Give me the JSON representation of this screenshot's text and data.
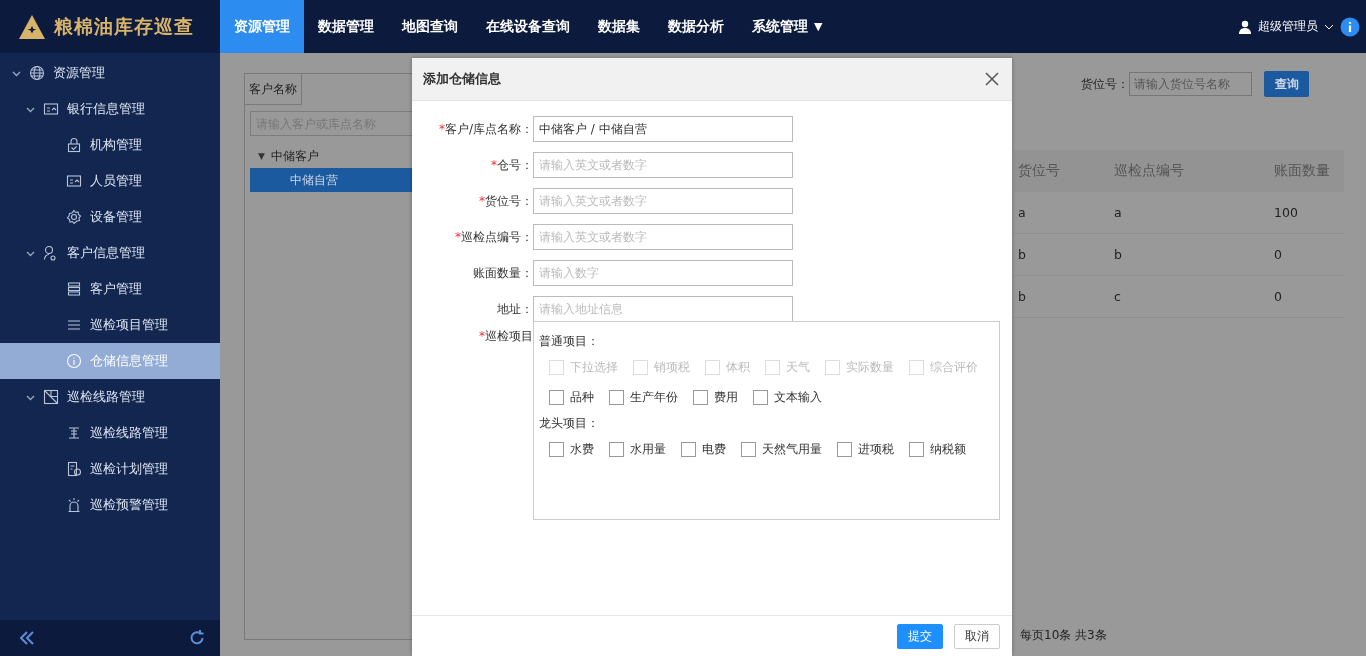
{
  "header": {
    "app_title": "粮棉油库存巡查",
    "nav": [
      {
        "label": "资源管理",
        "selected": true
      },
      {
        "label": "数据管理",
        "selected": false
      },
      {
        "label": "地图查询",
        "selected": false
      },
      {
        "label": "在线设备查询",
        "selected": false
      },
      {
        "label": "数据集",
        "selected": false
      },
      {
        "label": "数据分析",
        "selected": false
      },
      {
        "label": "系统管理",
        "selected": false,
        "caret": "▼"
      }
    ],
    "user": "超级管理员"
  },
  "sidebar": {
    "items": [
      {
        "label": "资源管理",
        "expanded": true,
        "selected": false,
        "children": [
          {
            "label": "银行信息管理",
            "expanded": true,
            "selected": false,
            "children": [
              {
                "label": "机构管理",
                "selected": false
              },
              {
                "label": "人员管理",
                "selected": false
              },
              {
                "label": "设备管理",
                "selected": false
              }
            ]
          },
          {
            "label": "客户信息管理",
            "expanded": true,
            "selected": false,
            "children": [
              {
                "label": "客户管理",
                "selected": false
              },
              {
                "label": "巡检项目管理",
                "selected": false
              },
              {
                "label": "仓储信息管理",
                "selected": true
              }
            ]
          },
          {
            "label": "巡检线路管理",
            "expanded": true,
            "selected": false,
            "children": [
              {
                "label": "巡检线路管理",
                "selected": false
              },
              {
                "label": "巡检计划管理",
                "selected": false
              },
              {
                "label": "巡检预警管理",
                "selected": false
              }
            ]
          }
        ]
      }
    ]
  },
  "tree_panel": {
    "tab": "客户名称",
    "search": {
      "placeholder": "请输入客户或库点名称"
    },
    "nodes": [
      {
        "label": "中储客户",
        "toggle": "▼",
        "expanded": true,
        "selected": false,
        "children": [
          {
            "label": "中储自营",
            "selected": true
          }
        ]
      }
    ]
  },
  "filter": {
    "label": "货位号：",
    "placeholder": "请输入货位号名称",
    "button": "查询"
  },
  "table": {
    "columns": [
      "货位号",
      "巡检点编号",
      "账面数量"
    ],
    "rows": [
      [
        "a",
        "a",
        "100"
      ],
      [
        "b",
        "b",
        "0"
      ],
      [
        "b",
        "c",
        "0"
      ]
    ]
  },
  "pagination": "每页10条 共3条",
  "dialog": {
    "title": "添加仓储信息",
    "fields": [
      {
        "label": "客户/库点名称：",
        "required_mark": "*",
        "value": "中储客户 / 中储自营"
      },
      {
        "label": "仓号：",
        "required_mark": "*",
        "placeholder": "请输入英文或者数字"
      },
      {
        "label": "货位号：",
        "required_mark": "*",
        "placeholder": "请输入英文或者数字"
      },
      {
        "label": "巡检点编号：",
        "required_mark": "*",
        "placeholder": "请输入英文或者数字"
      },
      {
        "label": "账面数量：",
        "placeholder": "请输入数字"
      },
      {
        "label": "地址：",
        "placeholder": "请输入地址信息"
      }
    ],
    "items_label": "巡检项目",
    "items_required_mark": "*",
    "groups": [
      {
        "title": "普通项目：",
        "rows": [
          [
            {
              "label": "下拉选择",
              "checked": false,
              "disabled": true
            },
            {
              "label": "销项税",
              "checked": false,
              "disabled": true
            },
            {
              "label": "体积",
              "checked": false,
              "disabled": true
            },
            {
              "label": "天气",
              "checked": false,
              "disabled": true
            },
            {
              "label": "实际数量",
              "checked": false,
              "disabled": true
            },
            {
              "label": "综合评价",
              "checked": false,
              "disabled": true
            }
          ],
          [
            {
              "label": "品种",
              "checked": false,
              "disabled": false
            },
            {
              "label": "生产年份",
              "checked": false,
              "disabled": false
            },
            {
              "label": "费用",
              "checked": false,
              "disabled": false
            },
            {
              "label": "文本输入",
              "checked": false,
              "disabled": false
            }
          ]
        ]
      },
      {
        "title": "龙头项目：",
        "rows": [
          [
            {
              "label": "水费",
              "checked": false,
              "disabled": false
            },
            {
              "label": "水用量",
              "checked": false,
              "disabled": false
            },
            {
              "label": "电费",
              "checked": false,
              "disabled": false
            },
            {
              "label": "天然气用量",
              "checked": false,
              "disabled": false
            },
            {
              "label": "进项税",
              "checked": false,
              "disabled": false
            },
            {
              "label": "纳税额",
              "checked": false,
              "disabled": false
            }
          ]
        ]
      }
    ],
    "buttons": [
      {
        "label": "提交",
        "kind": "primary"
      },
      {
        "label": "取消",
        "kind": "default"
      }
    ]
  }
}
